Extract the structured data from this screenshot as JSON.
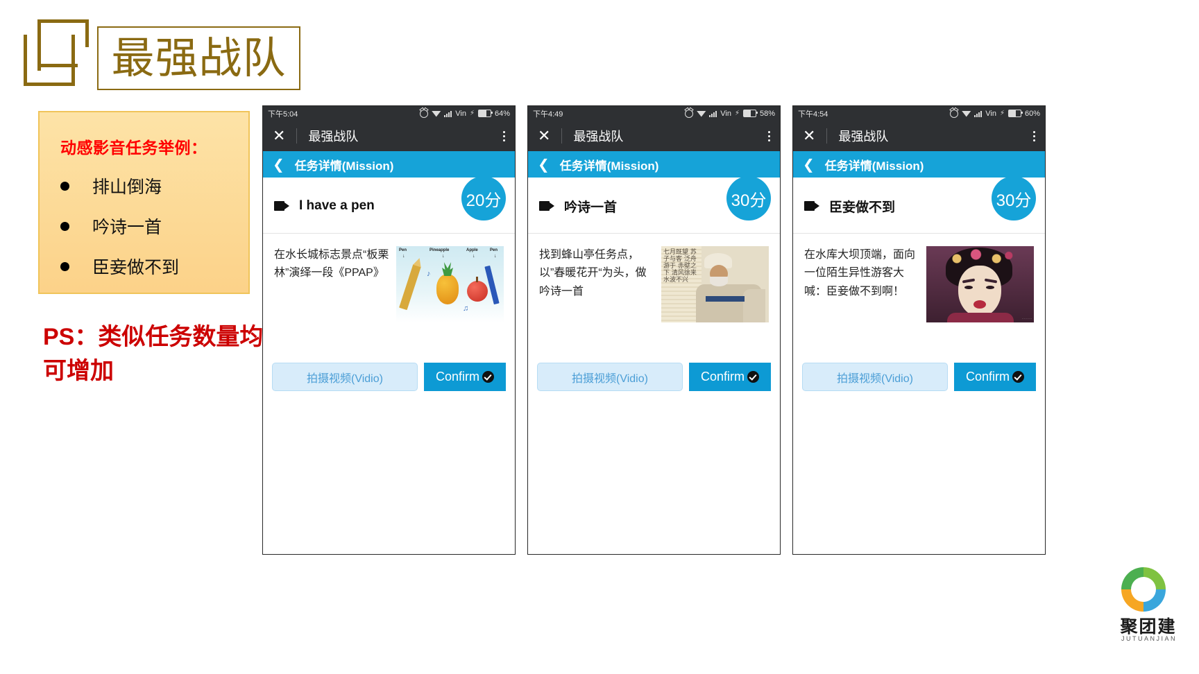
{
  "brand": {
    "title": "最强战队",
    "logo_icon": "bracket-logo-icon"
  },
  "callout": {
    "title": "动感影音任务举例：",
    "items": [
      "排山倒海",
      "吟诗一首",
      "臣妾做不到"
    ]
  },
  "ps_note": "PS：类似任务数量均可增加",
  "phones": [
    {
      "status": {
        "time": "下午5:04",
        "carrier": "Vin",
        "battery": "64%",
        "icons": [
          "alarm-icon",
          "wifi-icon",
          "signal-icon",
          "charging-bolt-icon",
          "battery-icon"
        ]
      },
      "appbar": {
        "close_label": "✕",
        "title": "最强战队",
        "menu_icon": "kebab-menu-icon"
      },
      "navbar": {
        "back_icon": "chevron-left-icon",
        "title": "任务详情(Mission)"
      },
      "mission": {
        "video_icon": "video-camera-icon",
        "title": "I have a pen",
        "score": "20分",
        "description": "在水长城标志景点“板栗林”演绎一段《PPAP》",
        "thumb_name": "ppap-illustration-thumbnail",
        "thumb_labels": [
          "Pen",
          "Pineapple",
          "Apple",
          "Pen"
        ]
      },
      "actions": {
        "record_label": "拍摄视频(Vidio)",
        "confirm_label": "Confirm",
        "confirm_icon": "check-circle-icon"
      }
    },
    {
      "status": {
        "time": "下午4:49",
        "carrier": "Vin",
        "battery": "58%",
        "icons": [
          "alarm-icon",
          "wifi-icon",
          "signal-icon",
          "charging-bolt-icon",
          "battery-icon"
        ]
      },
      "appbar": {
        "close_label": "✕",
        "title": "最强战队",
        "menu_icon": "kebab-menu-icon"
      },
      "navbar": {
        "back_icon": "chevron-left-icon",
        "title": "任务详情(Mission)"
      },
      "mission": {
        "video_icon": "video-camera-icon",
        "title": "吟诗一首",
        "score": "30分",
        "description": "找到蜂山亭任务点，以”春暖花开“为头，做吟诗一首",
        "thumb_name": "calligraphy-scholar-thumbnail",
        "thumb_labels": []
      },
      "actions": {
        "record_label": "拍摄视频(Vidio)",
        "confirm_label": "Confirm",
        "confirm_icon": "check-circle-icon"
      }
    },
    {
      "status": {
        "time": "下午4:54",
        "carrier": "Vin",
        "battery": "60%",
        "icons": [
          "alarm-icon",
          "wifi-icon",
          "signal-icon",
          "charging-bolt-icon",
          "battery-icon"
        ]
      },
      "appbar": {
        "close_label": "✕",
        "title": "最强战队",
        "menu_icon": "kebab-menu-icon"
      },
      "navbar": {
        "back_icon": "chevron-left-icon",
        "title": "任务详情(Mission)"
      },
      "mission": {
        "video_icon": "video-camera-icon",
        "title": "臣妾做不到",
        "score": "30分",
        "description": "在水库大坝顶端，面向一位陌生异性游客大喊：臣妾做不到啊！",
        "thumb_name": "opera-actress-thumbnail",
        "thumb_labels": []
      },
      "actions": {
        "record_label": "拍摄视频(Vidio)",
        "confirm_label": "Confirm",
        "confirm_icon": "check-circle-icon"
      }
    }
  ],
  "footer": {
    "brand_cn": "聚团建",
    "brand_py": "JUTUANJIAN",
    "logo_icon": "soccer-ball-logo-icon"
  },
  "colors": {
    "accent_blue": "#16a3d8",
    "gold": "#8a6a12",
    "callout_bg": "#fcd289",
    "red": "#cc0000",
    "statusbar": "#2e3033"
  },
  "calligraphy_ink": "七月既望 苏子与客 泛舟游于 赤壁之下 清风徐来 水波不兴"
}
